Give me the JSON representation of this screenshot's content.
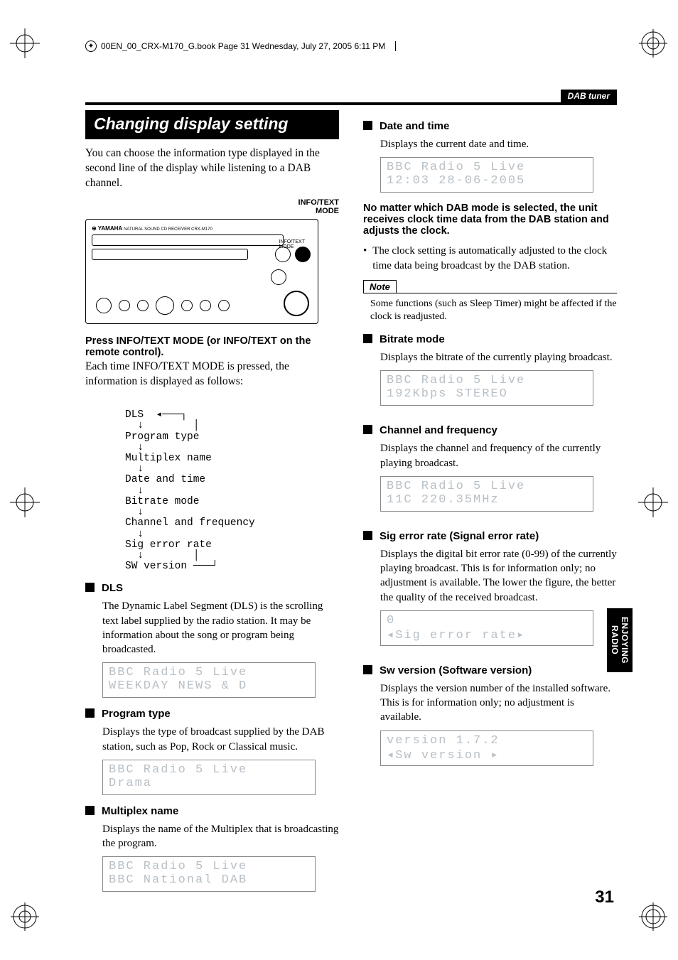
{
  "bookline": "00EN_00_CRX-M170_G.book   Page 31   Wednesday, July 27, 2005   6:11 PM",
  "breadcrumb": "DAB tuner",
  "sidetab": "ENJOYING\nRADIO",
  "pagenum": "31",
  "left": {
    "title": "Changing display setting",
    "intro": "You can choose the information type displayed in the second line of the display while listening to a DAB channel.",
    "pointer_label": "INFO/TEXT\nMODE",
    "instr_bold": "Press INFO/TEXT MODE (or INFO/TEXT on the remote control).",
    "instr_body": "Each time INFO/TEXT MODE is pressed, the information is displayed as follows:",
    "flow": [
      "DLS",
      "Program type",
      "Multiplex name",
      "Date and time",
      "Bitrate mode",
      "Channel and frequency",
      "Sig error rate",
      "SW version"
    ],
    "sections": [
      {
        "h": "DLS",
        "p": "The Dynamic Label Segment (DLS) is the scrolling text label supplied by the radio station. It may be information about the song or program being broadcasted.",
        "lcd": [
          "BBC Radio 5 Live",
          "WEEKDAY NEWS & D"
        ]
      },
      {
        "h": "Program type",
        "p": "Displays the type of broadcast supplied by the DAB station, such as Pop, Rock or Classical music.",
        "lcd": [
          "BBC Radio 5 Live",
          "Drama"
        ]
      },
      {
        "h": "Multiplex name",
        "p": "Displays the name of the Multiplex that is broadcasting the program.",
        "lcd": [
          "BBC Radio 5 Live",
          "BBC National DAB"
        ]
      }
    ]
  },
  "right": {
    "sections": [
      {
        "h": "Date and time",
        "p": "Displays the current date and time.",
        "lcd": [
          "BBC Radio 5 Live",
          "12:03 28-06-2005"
        ]
      },
      {
        "bold_after": "No matter which DAB mode is selected, the unit receives clock time data from the DAB station and adjusts the clock."
      },
      {
        "bullet": "The clock setting is automatically adjusted to the clock time data being broadcast by the DAB station."
      },
      {
        "note_label": "Note",
        "note_text": "Some functions (such as Sleep Timer) might be affected if the clock is readjusted."
      },
      {
        "h": "Bitrate mode",
        "p": "Displays the bitrate of the currently playing broadcast.",
        "lcd": [
          "BBC Radio 5 Live",
          "192Kbps STEREO"
        ]
      },
      {
        "h": "Channel and frequency",
        "p": "Displays the channel and frequency of the currently playing broadcast.",
        "lcd": [
          "BBC Radio 5 Live",
          "11C  220.35MHz"
        ]
      },
      {
        "h": "Sig error rate (Signal error rate)",
        "p": "Displays the digital bit error rate (0-99) of the currently playing broadcast. This is for information only; no adjustment is available. The lower the figure, the better the quality of the received broadcast.",
        "lcd": [
          "0",
          "◂Sig error rate▸"
        ]
      },
      {
        "h": "Sw version (Software version)",
        "p": "Displays the version number of the installed software. This is for information only; no adjustment is available.",
        "lcd": [
          "version 1.7.2",
          "◂Sw version    ▸"
        ]
      }
    ]
  }
}
